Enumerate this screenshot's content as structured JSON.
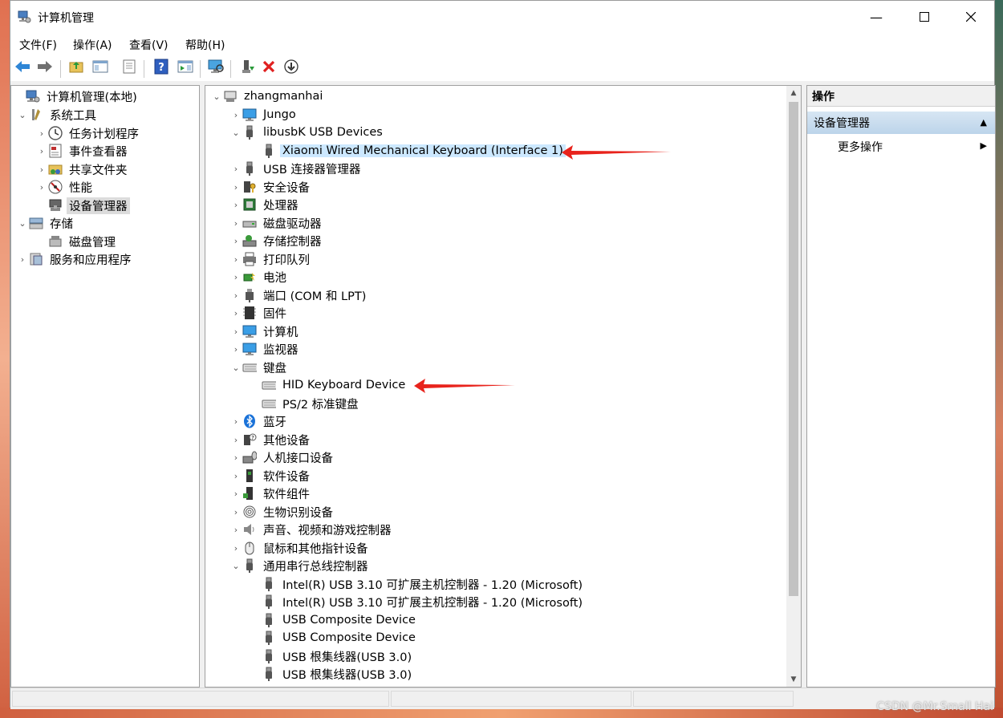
{
  "window": {
    "title": "计算机管理"
  },
  "menu": [
    "文件(F)",
    "操作(A)",
    "查看(V)",
    "帮助(H)"
  ],
  "left_tree": [
    {
      "label": "计算机管理(本地)",
      "icon": "computer-management-icon"
    },
    {
      "label": "系统工具",
      "icon": "tools-icon"
    },
    {
      "label": "任务计划程序",
      "icon": "clock-icon"
    },
    {
      "label": "事件查看器",
      "icon": "event-viewer-icon"
    },
    {
      "label": "共享文件夹",
      "icon": "shared-folder-icon"
    },
    {
      "label": "性能",
      "icon": "performance-icon"
    },
    {
      "label": "设备管理器",
      "icon": "device-manager-icon"
    },
    {
      "label": "存储",
      "icon": "storage-icon"
    },
    {
      "label": "磁盘管理",
      "icon": "disk-management-icon"
    },
    {
      "label": "服务和应用程序",
      "icon": "services-icon"
    }
  ],
  "device_tree": [
    {
      "label": "zhangmanhai",
      "icon": "computer-icon"
    },
    {
      "label": "Jungo",
      "icon": "monitor-icon"
    },
    {
      "label": "libusbK USB Devices",
      "icon": "usb-icon"
    },
    {
      "label": "Xiaomi Wired Mechanical Keyboard (Interface 1)",
      "icon": "usb-icon"
    },
    {
      "label": "USB 连接器管理器",
      "icon": "usb-icon"
    },
    {
      "label": "安全设备",
      "icon": "security-device-icon"
    },
    {
      "label": "处理器",
      "icon": "processor-icon"
    },
    {
      "label": "磁盘驱动器",
      "icon": "disk-drive-icon"
    },
    {
      "label": "存储控制器",
      "icon": "storage-controller-icon"
    },
    {
      "label": "打印队列",
      "icon": "printer-icon"
    },
    {
      "label": "电池",
      "icon": "battery-icon"
    },
    {
      "label": "端口 (COM 和 LPT)",
      "icon": "port-icon"
    },
    {
      "label": "固件",
      "icon": "firmware-icon"
    },
    {
      "label": "计算机",
      "icon": "monitor-icon"
    },
    {
      "label": "监视器",
      "icon": "monitor-icon"
    },
    {
      "label": "键盘",
      "icon": "keyboard-icon"
    },
    {
      "label": "HID Keyboard Device",
      "icon": "keyboard-icon"
    },
    {
      "label": "PS/2 标准键盘",
      "icon": "keyboard-icon"
    },
    {
      "label": "蓝牙",
      "icon": "bluetooth-icon"
    },
    {
      "label": "其他设备",
      "icon": "unknown-device-icon"
    },
    {
      "label": "人机接口设备",
      "icon": "hid-icon"
    },
    {
      "label": "软件设备",
      "icon": "software-device-icon"
    },
    {
      "label": "软件组件",
      "icon": "software-component-icon"
    },
    {
      "label": "生物识别设备",
      "icon": "fingerprint-icon"
    },
    {
      "label": "声音、视频和游戏控制器",
      "icon": "speaker-icon"
    },
    {
      "label": "鼠标和其他指针设备",
      "icon": "mouse-icon"
    },
    {
      "label": "通用串行总线控制器",
      "icon": "usb-icon"
    },
    {
      "label": "Intel(R) USB 3.10 可扩展主机控制器 - 1.20 (Microsoft)",
      "icon": "usb-icon"
    },
    {
      "label": "Intel(R) USB 3.10 可扩展主机控制器 - 1.20 (Microsoft)",
      "icon": "usb-icon"
    },
    {
      "label": "USB Composite Device",
      "icon": "usb-icon"
    },
    {
      "label": "USB Composite Device",
      "icon": "usb-icon"
    },
    {
      "label": "USB 根集线器(USB 3.0)",
      "icon": "usb-icon"
    },
    {
      "label": "USB 根集线器(USB 3.0)",
      "icon": "usb-icon"
    }
  ],
  "actions": {
    "header": "操作",
    "section": "设备管理器",
    "more": "更多操作"
  },
  "watermark": "CSDN @Mr.Small Hai",
  "colors": {
    "selection_blue": "#cce8ff",
    "annotation_arrow": "#e8231c"
  }
}
